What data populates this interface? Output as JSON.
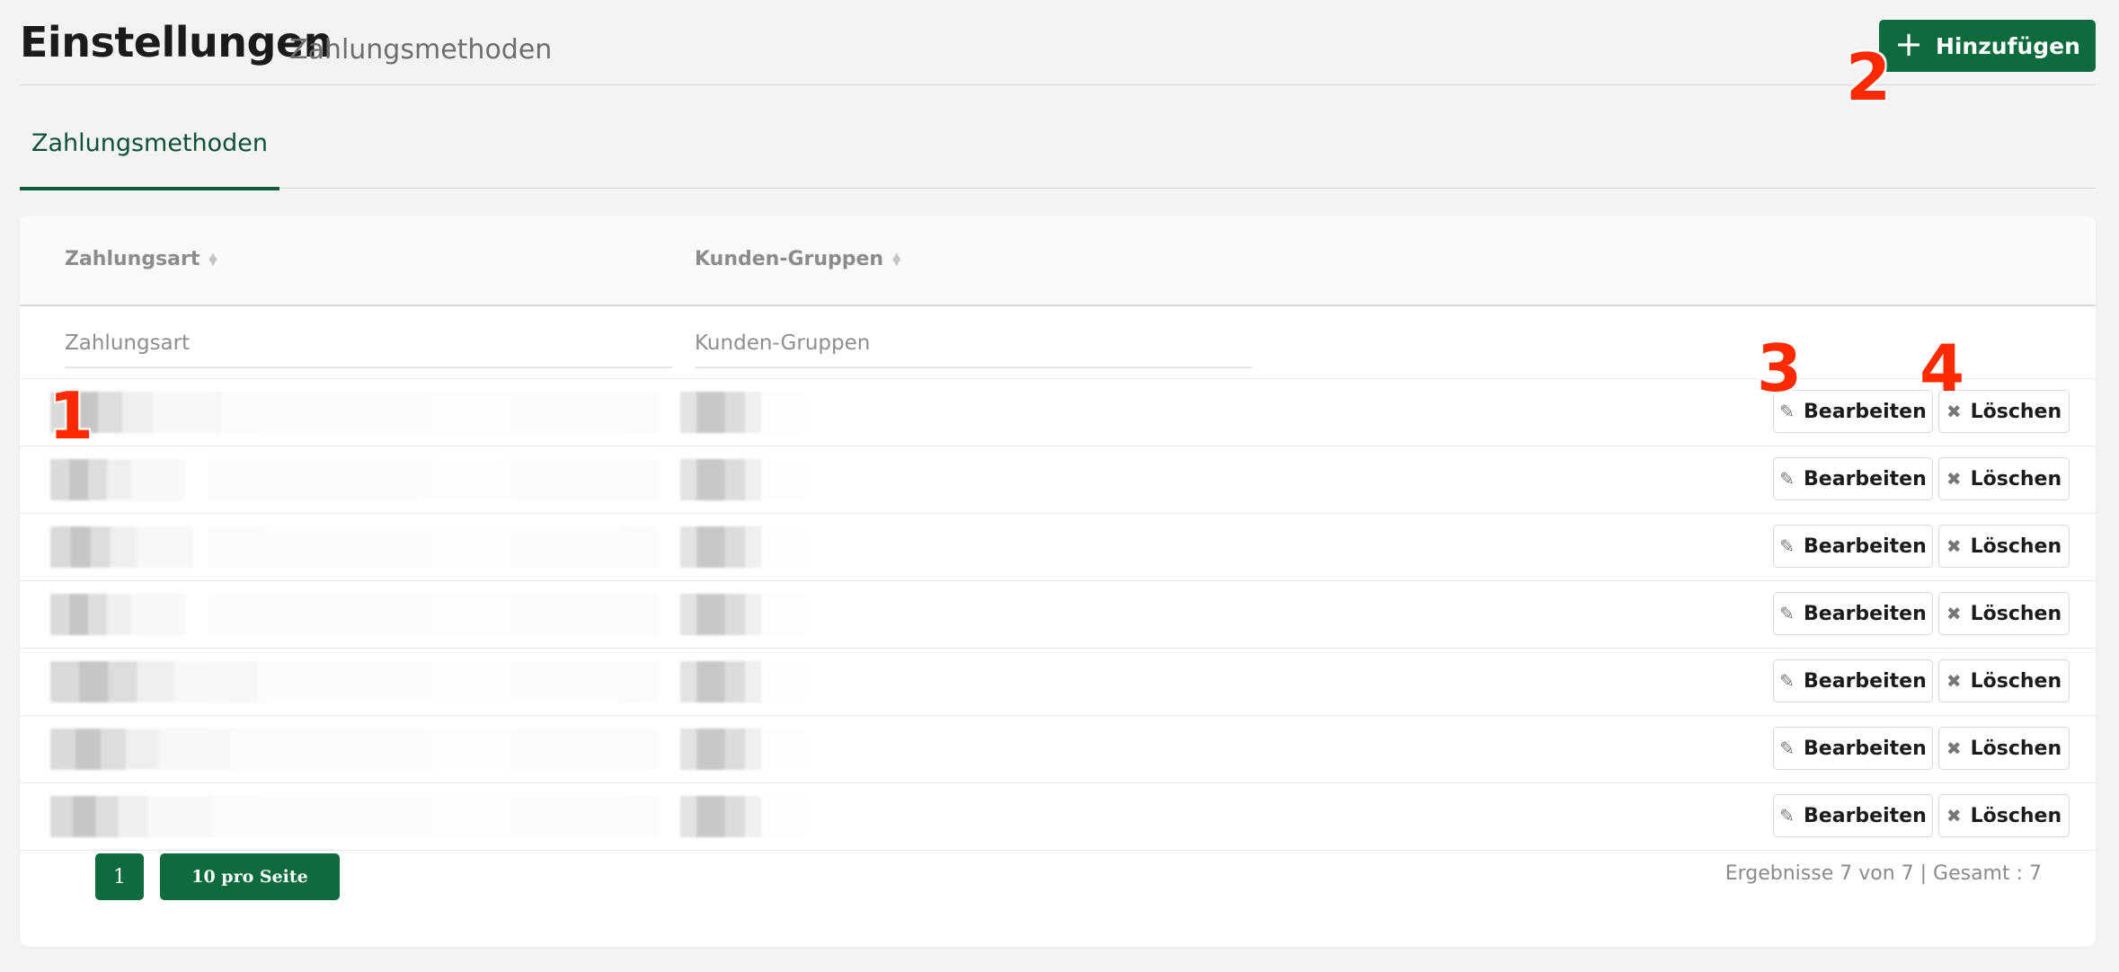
{
  "header": {
    "title": "Einstellungen",
    "subtitle": "Zahlungsmethoden",
    "add_label": "Hinzufügen"
  },
  "tabs": [
    {
      "label": "Zahlungsmethoden",
      "active": true
    }
  ],
  "table": {
    "columns": [
      {
        "label": "Zahlungsart",
        "sortable": true
      },
      {
        "label": "Kunden-Gruppen",
        "sortable": true
      }
    ],
    "filters": {
      "zahlungsart_placeholder": "Zahlungsart",
      "kundengruppen_placeholder": "Kunden-Gruppen"
    },
    "row_count": 7,
    "edit_label": "Bearbeiten",
    "delete_label": "Löschen"
  },
  "pagination": {
    "current_page": "1",
    "per_page_label": "10 pro Seite",
    "results_text": "Ergebnisse 7 von 7 | Gesamt : 7"
  },
  "annotations": [
    "1",
    "2",
    "3",
    "4"
  ],
  "colors": {
    "accent": "#0d6b3d",
    "marker": "#ff2a00",
    "background": "#f3f3f3"
  },
  "icons": {
    "add": "plus-icon",
    "edit": "edit-icon",
    "delete": "x-icon",
    "sort": "sort-icon"
  }
}
